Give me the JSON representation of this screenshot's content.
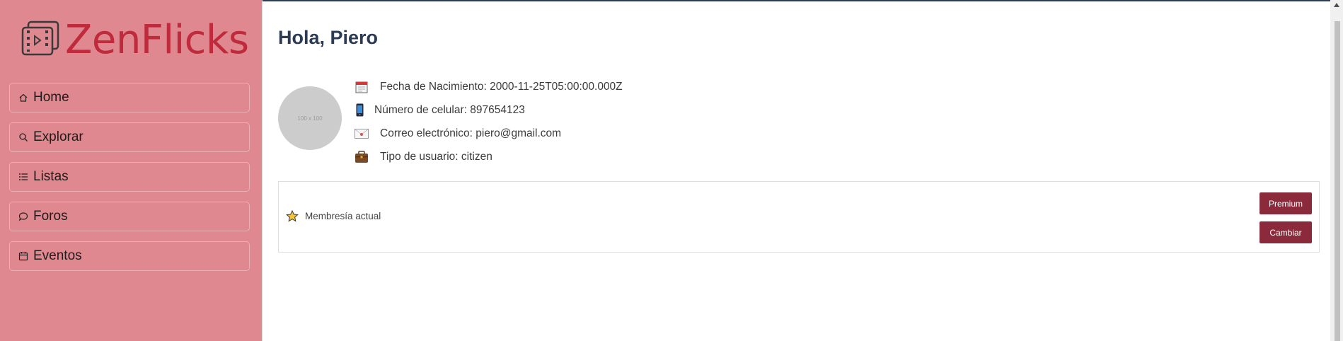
{
  "brand": {
    "name": "ZenFlicks",
    "color": "#bf2a3c"
  },
  "sidebar": {
    "items": [
      {
        "label": "Home",
        "icon": "home-icon"
      },
      {
        "label": "Explorar",
        "icon": "search-icon"
      },
      {
        "label": "Listas",
        "icon": "list-icon"
      },
      {
        "label": "Foros",
        "icon": "chat-icon"
      },
      {
        "label": "Eventos",
        "icon": "calendar-icon"
      }
    ]
  },
  "profile": {
    "greeting": "Hola, Piero",
    "avatar_placeholder": "100 x 100",
    "birthdate": "Fecha de Nacimiento: 2000-11-25T05:00:00.000Z",
    "phone": "Número de celular: 897654123",
    "email": "Correo electrónico: piero@gmail.com",
    "user_type": "Tipo de usuario: citizen"
  },
  "membership": {
    "label": "Membresía actual",
    "plan_button": "Premium",
    "change_button": "Cambiar"
  },
  "colors": {
    "sidebar_bg": "#e0888f",
    "button_bg": "#8b2a3a",
    "heading": "#2b3a55"
  }
}
